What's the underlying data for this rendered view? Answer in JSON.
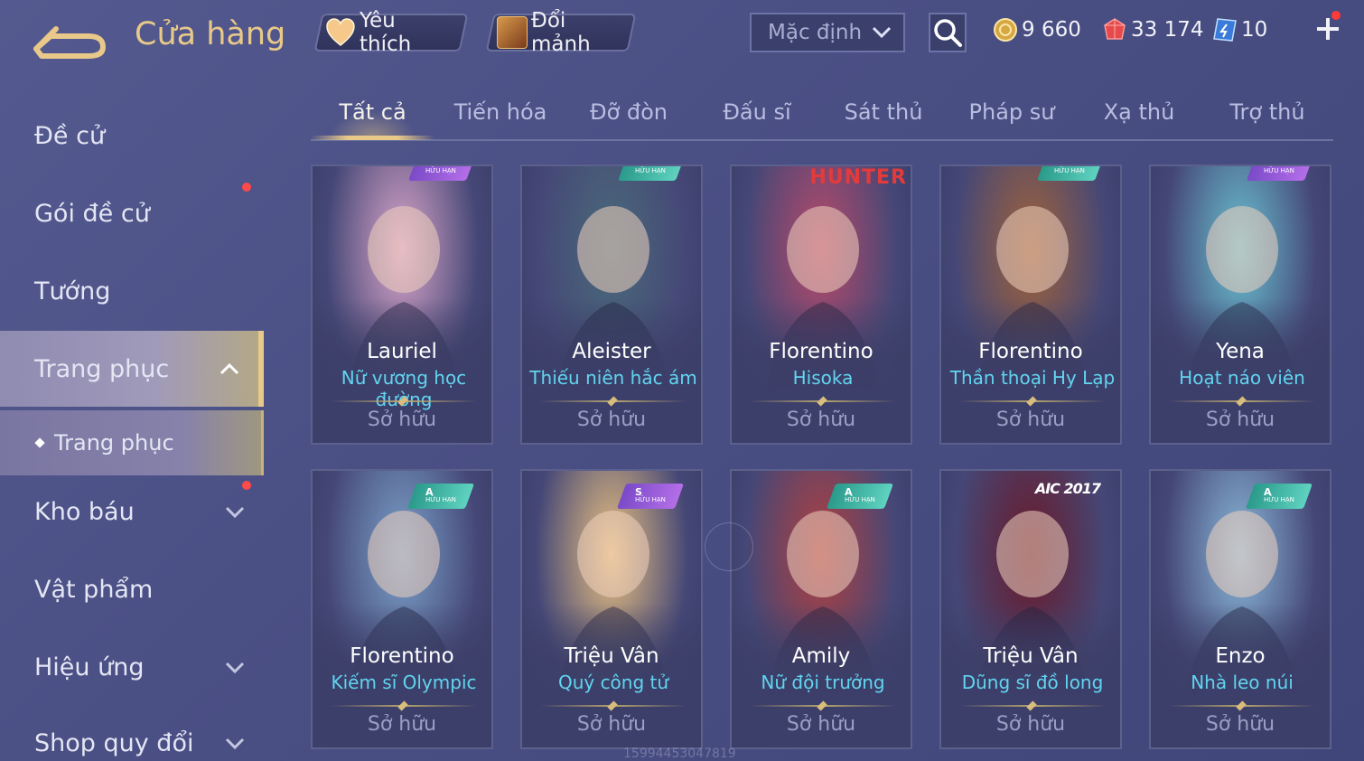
{
  "header": {
    "title": "Cửa hàng",
    "favorites_label": "Yêu thích",
    "shard_exchange_label": "Đổi mảnh",
    "sort_value": "Mặc định",
    "currency": {
      "gold": "9 660",
      "gems": "33 174",
      "vouchers": "10"
    },
    "icons": {
      "back": "back-arrow-icon",
      "favorite": "heart-icon",
      "shard": "shard-chest-icon",
      "search": "search-icon",
      "gold": "gold-coin-icon",
      "gem": "ruby-icon",
      "voucher": "voucher-icon",
      "add": "plus-icon"
    }
  },
  "sidebar": {
    "items": [
      {
        "label": "Đề cử"
      },
      {
        "label": "Gói đề cử"
      },
      {
        "label": "Tướng"
      },
      {
        "label": "Trang phục"
      },
      {
        "label": "Trang phục"
      },
      {
        "label": "Kho báu"
      },
      {
        "label": "Vật phẩm"
      },
      {
        "label": "Hiệu ứng"
      },
      {
        "label": "Shop quy đổi"
      }
    ]
  },
  "tabs": [
    "Tất cả",
    "Tiến hóa",
    "Đỡ đòn",
    "Đấu sĩ",
    "Sát thủ",
    "Pháp sư",
    "Xạ thủ",
    "Trợ thủ"
  ],
  "cards": [
    {
      "hero": "Lauriel",
      "skin": "Nữ vương học đường",
      "status": "Sở hữu",
      "badge": "HỮU HẠN",
      "accent": "#d9a5c8"
    },
    {
      "hero": "Aleister",
      "skin": "Thiếu niên hắc ám",
      "status": "Sở hữu",
      "badge": "HỮU HẠN",
      "accent": "#4a6a7a"
    },
    {
      "hero": "Florentino",
      "skin": "Hisoka",
      "status": "Sở hữu",
      "badge": "HUNTER",
      "accent": "#b84a6a"
    },
    {
      "hero": "Florentino",
      "skin": "Thần thoại Hy Lạp",
      "status": "Sở hữu",
      "badge": "HỮU HẠN",
      "accent": "#a0623a"
    },
    {
      "hero": "Yena",
      "skin": "Hoạt náo viên",
      "status": "Sở hữu",
      "badge": "HỮU HẠN",
      "accent": "#6ac0d0"
    },
    {
      "hero": "Florentino",
      "skin": "Kiếm sĩ Olympic",
      "status": "Sở hữu",
      "badge_grade": "A",
      "badge": "HỮU HẠN",
      "accent": "#7aa0c8"
    },
    {
      "hero": "Triệu Vân",
      "skin": "Quý công tử",
      "status": "Sở hữu",
      "badge_grade": "S",
      "badge": "HỮU HẠN",
      "accent": "#e8c080"
    },
    {
      "hero": "Amily",
      "skin": "Nữ đội trưởng",
      "status": "Sở hữu",
      "badge_grade": "A",
      "badge": "HỮU HẠN",
      "accent": "#b04040"
    },
    {
      "hero": "Triệu Vân",
      "skin": "Dũng sĩ đồ long",
      "status": "Sở hữu",
      "badge": "AIC 2017",
      "accent": "#6a1a2a"
    },
    {
      "hero": "Enzo",
      "skin": "Nhà leo núi",
      "status": "Sở hữu",
      "badge_grade": "A",
      "badge": "HỮU HẠN",
      "accent": "#8ab8d8"
    }
  ],
  "watermark": "15994453047819"
}
